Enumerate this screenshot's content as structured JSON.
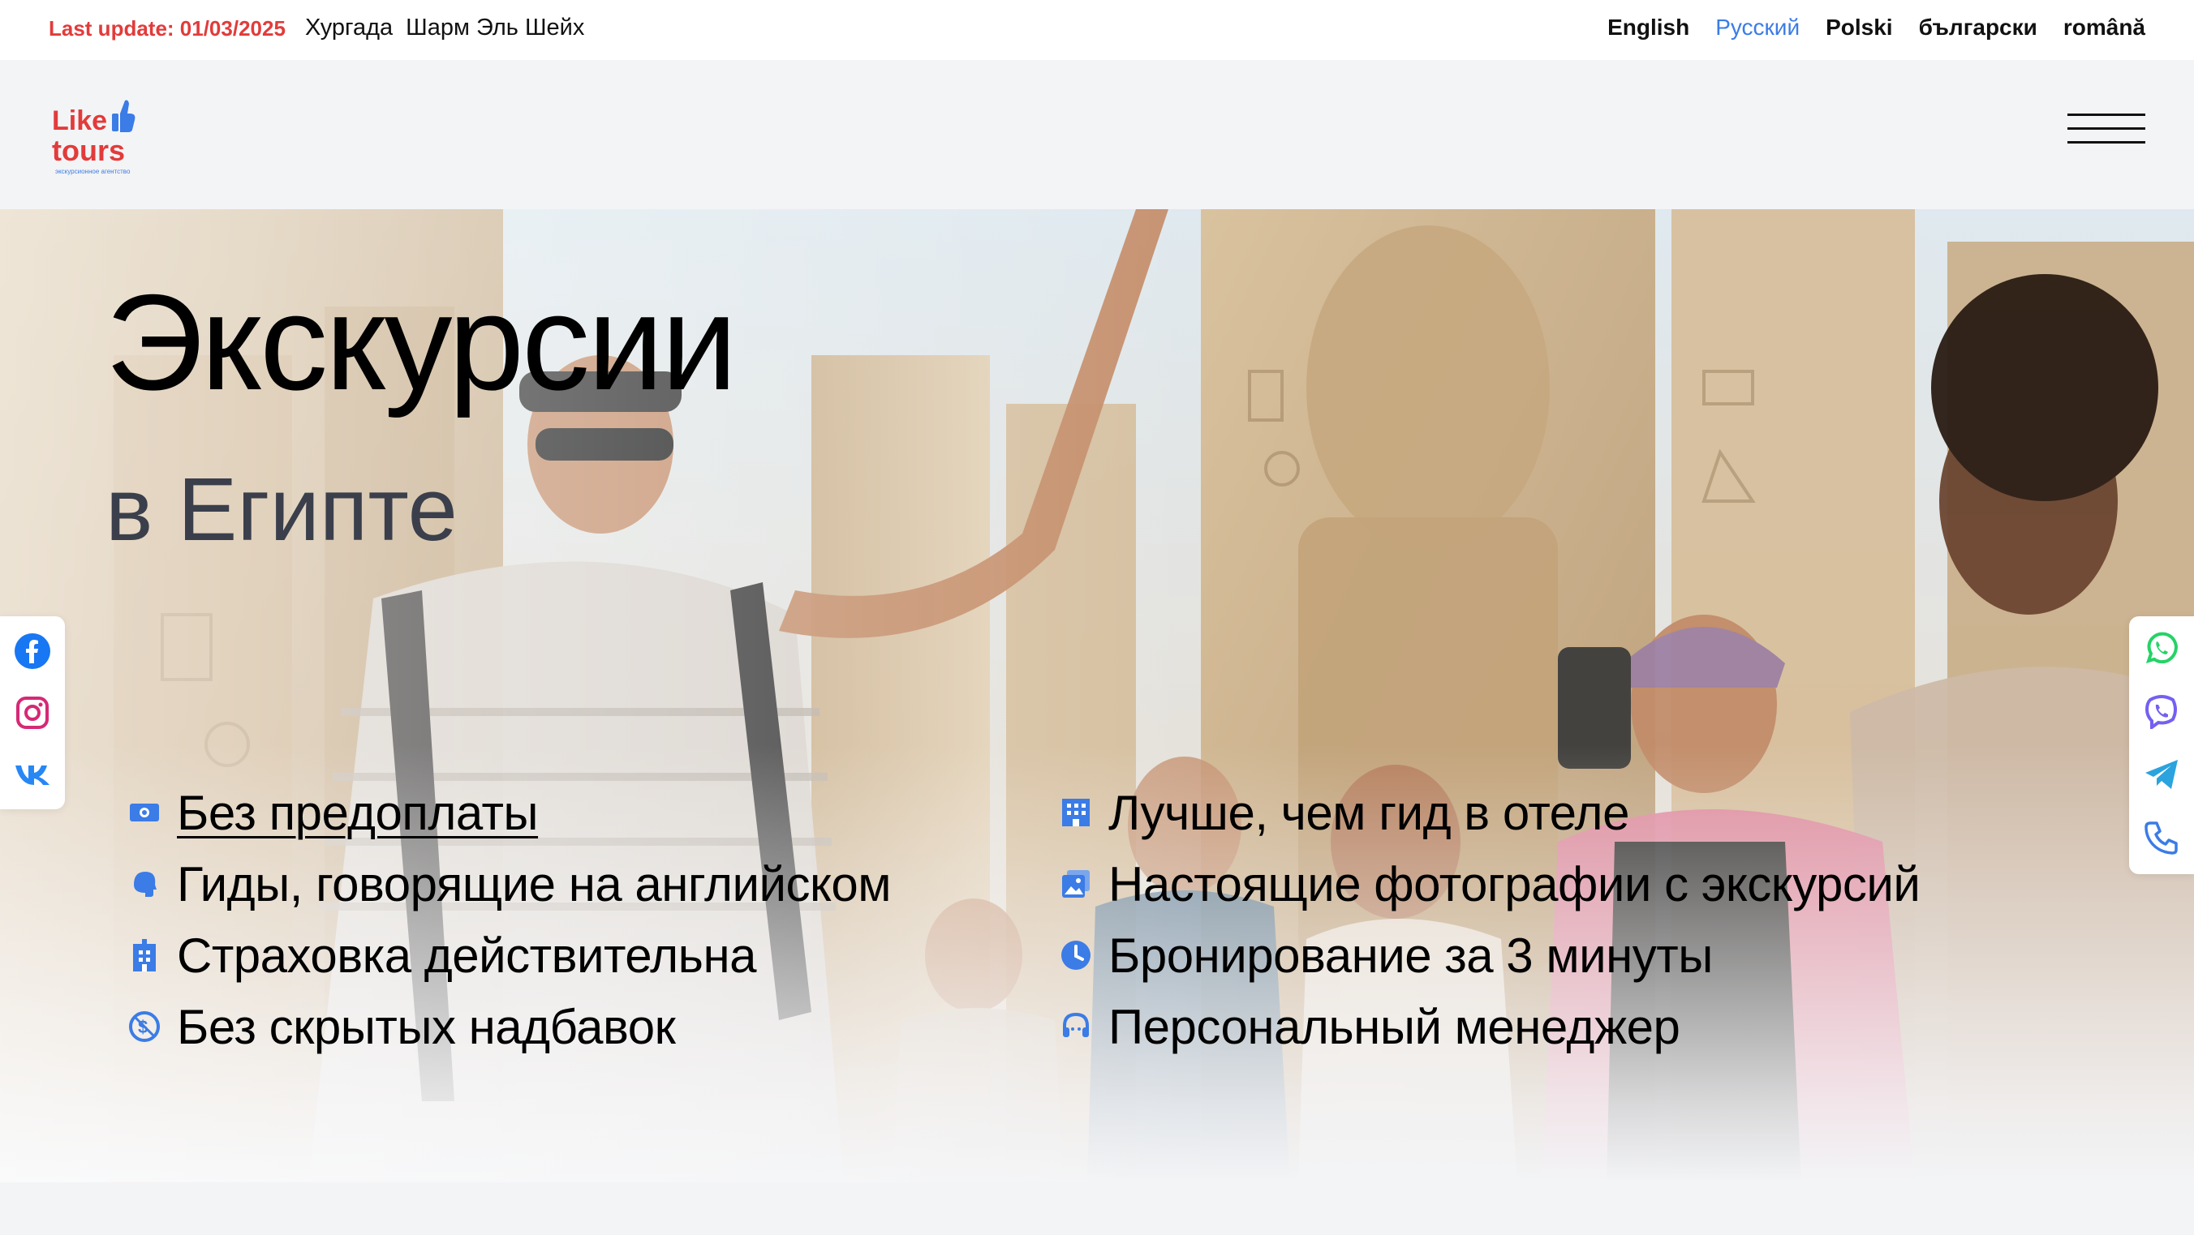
{
  "topbar": {
    "last_update": "Last update: 01/03/2025",
    "cities": [
      "Хургада",
      "Шарм Эль Шейх"
    ],
    "languages": [
      {
        "label": "English",
        "active": false
      },
      {
        "label": "Русский",
        "active": true
      },
      {
        "label": "Polski",
        "active": false
      },
      {
        "label": "български",
        "active": false
      },
      {
        "label": "română",
        "active": false
      }
    ]
  },
  "logo": {
    "line1": "Like",
    "line2": "tours",
    "tagline": "экскурсионное агентство"
  },
  "hero": {
    "title": "Экскурсии",
    "subtitle": "в Египте",
    "features_left": [
      {
        "icon": "money-icon",
        "text": "Без предоплаты"
      },
      {
        "icon": "speaking-head-icon",
        "text": "Гиды, говорящие на английском"
      },
      {
        "icon": "hospital-icon",
        "text": "Страховка действительна"
      },
      {
        "icon": "no-dollar-icon",
        "text": "Без скрытых надбавок"
      }
    ],
    "features_right": [
      {
        "icon": "hotel-icon",
        "text": "Лучше, чем гид в отеле"
      },
      {
        "icon": "photos-icon",
        "text": "Настоящие фотографии с экскурсий"
      },
      {
        "icon": "clock-icon",
        "text": "Бронирование за 3 минуты"
      },
      {
        "icon": "headset-icon",
        "text": "Персональный менеджер"
      }
    ]
  },
  "social_left": [
    "facebook-icon",
    "instagram-icon",
    "vk-icon"
  ],
  "social_right": [
    "whatsapp-icon",
    "viber-icon",
    "telegram-icon",
    "phone-icon"
  ],
  "colors": {
    "accent_blue": "#3b7ce6",
    "brand_red": "#e23b3b",
    "whatsapp": "#25d366",
    "viber": "#7360f2",
    "telegram": "#2aa3df"
  }
}
